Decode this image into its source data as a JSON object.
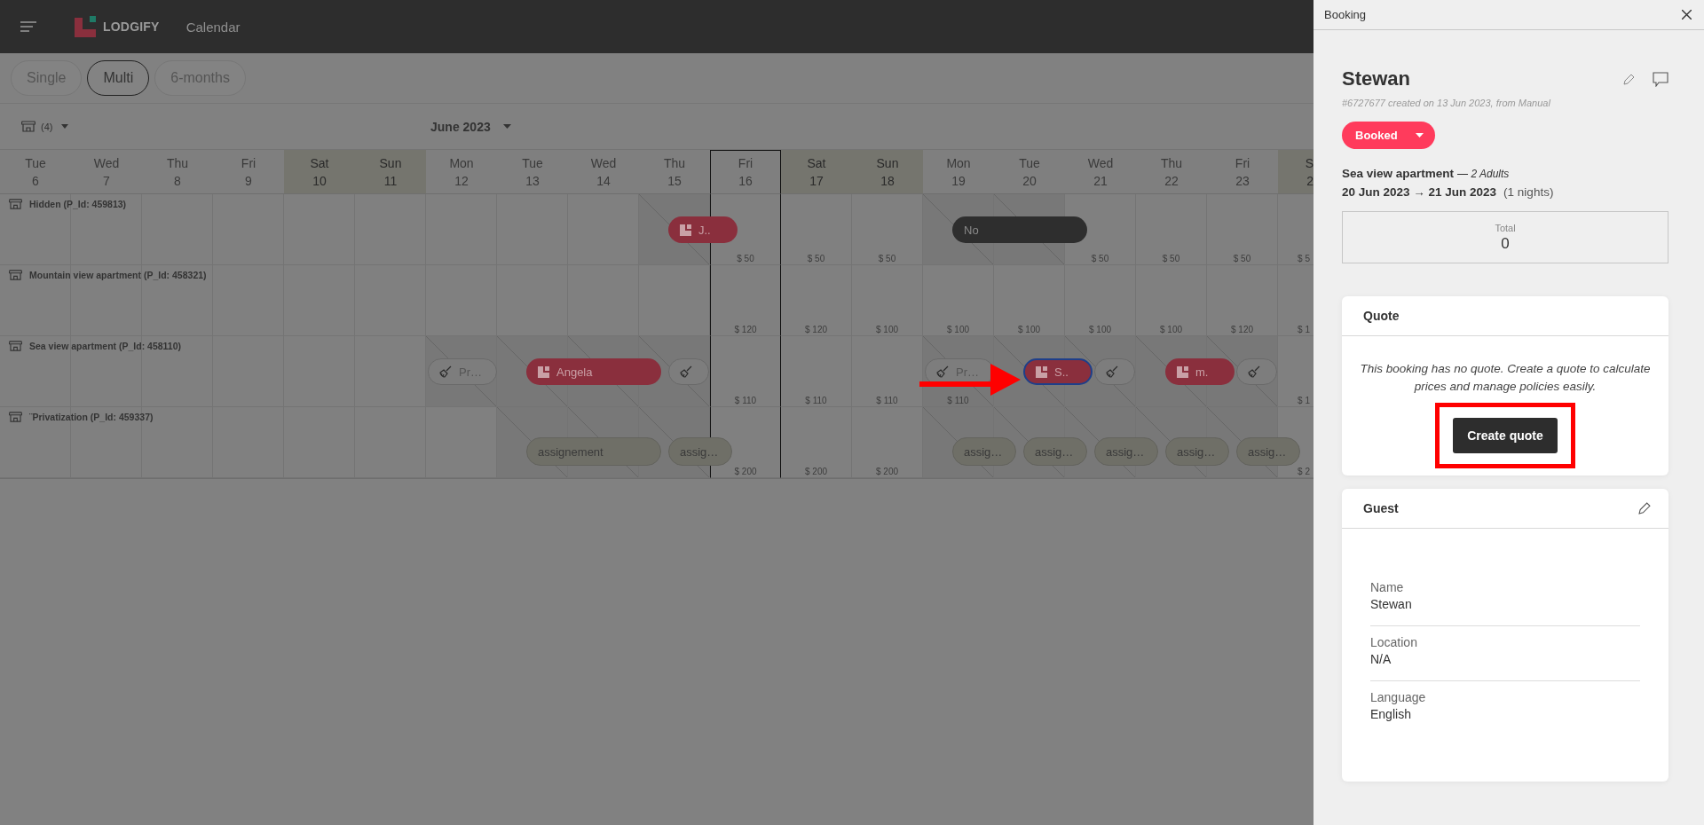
{
  "header": {
    "app_name": "LODGIFY",
    "page_title": "Calendar"
  },
  "views": [
    {
      "label": "Single",
      "selected": false
    },
    {
      "label": "Multi",
      "selected": true
    },
    {
      "label": "6-months",
      "selected": false
    }
  ],
  "filter": {
    "count": "(4)"
  },
  "month": "June 2023",
  "days": [
    {
      "weekday": "Tue",
      "date": "6",
      "weekend": false,
      "today": false
    },
    {
      "weekday": "Wed",
      "date": "7",
      "weekend": false,
      "today": false
    },
    {
      "weekday": "Thu",
      "date": "8",
      "weekend": false,
      "today": false
    },
    {
      "weekday": "Fri",
      "date": "9",
      "weekend": false,
      "today": false
    },
    {
      "weekday": "Sat",
      "date": "10",
      "weekend": true,
      "today": false
    },
    {
      "weekday": "Sun",
      "date": "11",
      "weekend": true,
      "today": false
    },
    {
      "weekday": "Mon",
      "date": "12",
      "weekend": false,
      "today": false
    },
    {
      "weekday": "Tue",
      "date": "13",
      "weekend": false,
      "today": false
    },
    {
      "weekday": "Wed",
      "date": "14",
      "weekend": false,
      "today": false
    },
    {
      "weekday": "Thu",
      "date": "15",
      "weekend": false,
      "today": false
    },
    {
      "weekday": "Fri",
      "date": "16",
      "weekend": false,
      "today": true
    },
    {
      "weekday": "Sat",
      "date": "17",
      "weekend": true,
      "today": false
    },
    {
      "weekday": "Sun",
      "date": "18",
      "weekend": true,
      "today": false
    },
    {
      "weekday": "Mon",
      "date": "19",
      "weekend": false,
      "today": false
    },
    {
      "weekday": "Tue",
      "date": "20",
      "weekend": false,
      "today": false
    },
    {
      "weekday": "Wed",
      "date": "21",
      "weekend": false,
      "today": false
    },
    {
      "weekday": "Thu",
      "date": "22",
      "weekend": false,
      "today": false
    },
    {
      "weekday": "Fri",
      "date": "23",
      "weekend": false,
      "today": false
    },
    {
      "weekday": "S",
      "date": "2",
      "weekend": true,
      "today": false
    }
  ],
  "properties": [
    {
      "name": "Hidden (P_Id: 459813)",
      "cells": [
        {
          "blocked": false
        },
        {
          "blocked": false
        },
        {
          "blocked": false
        },
        {
          "blocked": false
        },
        {
          "blocked": false
        },
        {
          "blocked": false
        },
        {
          "blocked": false
        },
        {
          "blocked": false
        },
        {
          "blocked": false
        },
        {
          "blocked": true,
          "pill": {
            "kind": "booking",
            "label": "J..",
            "wide": false,
            "midday": true,
            "selected": false
          }
        },
        {
          "blocked": false,
          "price": "$ 50"
        },
        {
          "blocked": false,
          "price": "$ 50"
        },
        {
          "blocked": false,
          "price": "$ 50"
        },
        {
          "blocked": true,
          "pill": {
            "kind": "blocked",
            "label": "No",
            "wide": true,
            "midday": true
          }
        },
        {
          "blocked": true
        },
        {
          "blocked": false,
          "price": "$ 50"
        },
        {
          "blocked": false,
          "price": "$ 50"
        },
        {
          "blocked": false,
          "price": "$ 50"
        },
        {
          "blocked": false,
          "price": "$ 5"
        }
      ]
    },
    {
      "name": "Mountain view apartment (P_Id: 458321)",
      "cells": [
        {
          "blocked": false
        },
        {
          "blocked": false
        },
        {
          "blocked": false
        },
        {
          "blocked": false
        },
        {
          "blocked": false
        },
        {
          "blocked": false
        },
        {
          "blocked": false
        },
        {
          "blocked": false
        },
        {
          "blocked": false
        },
        {
          "blocked": false
        },
        {
          "blocked": false,
          "price": "$ 120"
        },
        {
          "blocked": false,
          "price": "$ 120"
        },
        {
          "blocked": false,
          "price": "$ 100"
        },
        {
          "blocked": false,
          "price": "$ 100"
        },
        {
          "blocked": false,
          "price": "$ 100"
        },
        {
          "blocked": false,
          "price": "$ 100"
        },
        {
          "blocked": false,
          "price": "$ 100"
        },
        {
          "blocked": false,
          "price": "$ 120"
        },
        {
          "blocked": false,
          "price": "$ 1"
        }
      ]
    },
    {
      "name": "Sea view apartment (P_Id: 458110)",
      "cells": [
        {
          "blocked": false
        },
        {
          "blocked": false
        },
        {
          "blocked": false
        },
        {
          "blocked": false
        },
        {
          "blocked": false
        },
        {
          "blocked": false
        },
        {
          "blocked": true,
          "pill": {
            "kind": "cleaning",
            "label": "Pr…",
            "wide": false,
            "midday": false
          }
        },
        {
          "blocked": true,
          "pill": {
            "kind": "booking",
            "label": "Angela",
            "wide": true,
            "midday": true,
            "selected": false
          }
        },
        {
          "blocked": true
        },
        {
          "blocked": true,
          "pill": {
            "kind": "cleaning",
            "wide": false,
            "midday": true
          }
        },
        {
          "blocked": false,
          "price": "$ 110"
        },
        {
          "blocked": false,
          "price": "$ 110"
        },
        {
          "blocked": false,
          "price": "$ 110"
        },
        {
          "blocked": true,
          "price": "$ 110",
          "pill": {
            "kind": "cleaning",
            "label": "Pr…",
            "wide": false,
            "midday": false
          }
        },
        {
          "blocked": true,
          "pill": {
            "kind": "booking",
            "label": "S..",
            "wide": false,
            "midday": true,
            "selected": true
          }
        },
        {
          "blocked": true,
          "pill": {
            "kind": "cleaning",
            "wide": false,
            "midday": true
          }
        },
        {
          "blocked": true,
          "pill": {
            "kind": "booking",
            "label": "m.",
            "wide": false,
            "midday": true,
            "selected": false
          }
        },
        {
          "blocked": true,
          "pill": {
            "kind": "cleaning",
            "wide": false,
            "midday": true
          }
        },
        {
          "blocked": false,
          "price": "$ 1"
        }
      ]
    },
    {
      "name": "¨Privatization (P_Id: 459337)",
      "cells": [
        {
          "blocked": false
        },
        {
          "blocked": false
        },
        {
          "blocked": false
        },
        {
          "blocked": false
        },
        {
          "blocked": false
        },
        {
          "blocked": false
        },
        {
          "blocked": false
        },
        {
          "blocked": true,
          "pill": {
            "kind": "assignment",
            "label": "assignement",
            "wide": true,
            "midday": true
          }
        },
        {
          "blocked": true
        },
        {
          "blocked": true,
          "pill": {
            "kind": "assignment",
            "label": "assig…",
            "wide": false,
            "midday": true
          }
        },
        {
          "blocked": false,
          "price": "$ 200"
        },
        {
          "blocked": false,
          "price": "$ 200"
        },
        {
          "blocked": false,
          "price": "$ 200"
        },
        {
          "blocked": true,
          "pill": {
            "kind": "assignment",
            "label": "assig…",
            "wide": false,
            "midday": true
          }
        },
        {
          "blocked": true,
          "pill": {
            "kind": "assignment",
            "label": "assig…",
            "wide": false,
            "midday": true
          }
        },
        {
          "blocked": true,
          "pill": {
            "kind": "assignment",
            "label": "assig…",
            "wide": false,
            "midday": true
          }
        },
        {
          "blocked": true,
          "pill": {
            "kind": "assignment",
            "label": "assig…",
            "wide": false,
            "midday": true
          }
        },
        {
          "blocked": true,
          "pill": {
            "kind": "assignment",
            "label": "assig…",
            "wide": false,
            "midday": true
          }
        },
        {
          "blocked": false,
          "price": "$ 2"
        }
      ]
    }
  ],
  "panel": {
    "title": "Booking",
    "guest_name": "Stewan",
    "meta": "#6727677 created on 13 Jun 2023, from Manual",
    "status": "Booked",
    "property": "Sea view apartment",
    "guests": "— 2 Adults",
    "dates": "20 Jun 2023 → 21 Jun 2023",
    "nights": "(1 nights)",
    "total_label": "Total",
    "total_value": "0",
    "quote": {
      "title": "Quote",
      "message": "This booking has no quote. Create a quote to calculate prices and manage policies easily.",
      "button": "Create quote"
    },
    "guest": {
      "title": "Guest",
      "fields": [
        {
          "label": "Name",
          "value": "Stewan"
        },
        {
          "label": "Location",
          "value": "N/A"
        },
        {
          "label": "Language",
          "value": "English"
        }
      ]
    }
  }
}
